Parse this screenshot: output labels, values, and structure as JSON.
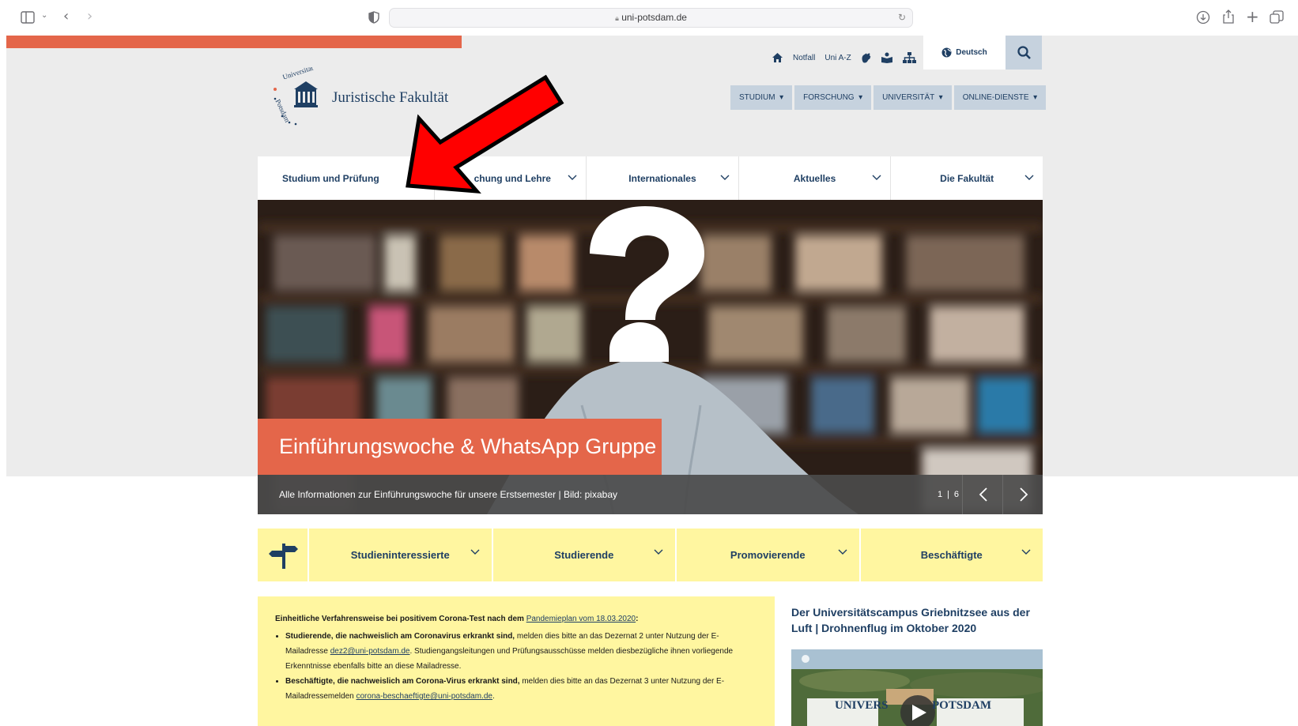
{
  "browser": {
    "url": "uni-potsdam.de"
  },
  "topbar": {
    "links": [
      "Notfall",
      "Uni A-Z"
    ],
    "language": "Deutsch"
  },
  "mainnav": [
    "STUDIUM",
    "FORSCHUNG",
    "UNIVERSITÄT",
    "ONLINE-DIENSTE"
  ],
  "logo": {
    "arc_text": "Universität Potsdam",
    "name": "Juristische Fakultät"
  },
  "facnav": [
    "Studium und Prüfung",
    "Forschung und Lehre",
    "Internationales",
    "Aktuelles",
    "Die Fakultät"
  ],
  "facnav_visible_second": "chung und Lehre",
  "hero": {
    "title": "Einführungswoche & WhatsApp Gruppe",
    "caption": "Alle Informationen zur Einführungswoche für unsere Erstsemester | Bild: pixabay",
    "page_current": "1",
    "page_total": "6"
  },
  "target_groups": [
    "Studieninteressierte",
    "Studierende",
    "Promovierende",
    "Beschäftigte"
  ],
  "notice": {
    "heading_text": "Einheitliche Verfahrensweise bei positivem Corona-Test nach dem ",
    "heading_link": "Pandemieplan vom 18.03.2020",
    "heading_end": ":",
    "item1_bold": "Studierende, die nachweislich am Coronavirus erkrankt sind,",
    "item1_text_a": " melden dies bitte an das Dezernat 2 unter Nutzung der E-Mailadresse ",
    "item1_link": "dez2@uni-potsdam.de",
    "item1_text_b": ". Studiengangsleitungen und Prüfungsausschüsse melden diesbezügliche ihnen vorliegende Erkenntnisse ebenfalls bitte an diese Mailadresse.",
    "item2_bold": "Beschäftigte, die nachweislich am Corona-Virus erkrankt sind,",
    "item2_text_a": " melden dies bitte an das Dezernat 3 unter Nutzung der E-Mailadressemelden ",
    "item2_link": "corona-beschaeftigte@uni-potsdam.de",
    "item2_text_b": "."
  },
  "side": {
    "title": "Der Universitätscampus Griebnitzsee aus der Luft | Drohnenflug im Oktober 2020",
    "video_overlay_left": "UNIVERS",
    "video_overlay_right": "POTSDAM"
  },
  "colors": {
    "accent_red": "#e4664a",
    "navy": "#1f3f63",
    "yellow": "#fff6a0",
    "nav_blue": "#c6d2de",
    "annotation_arrow": "#ff0000"
  }
}
